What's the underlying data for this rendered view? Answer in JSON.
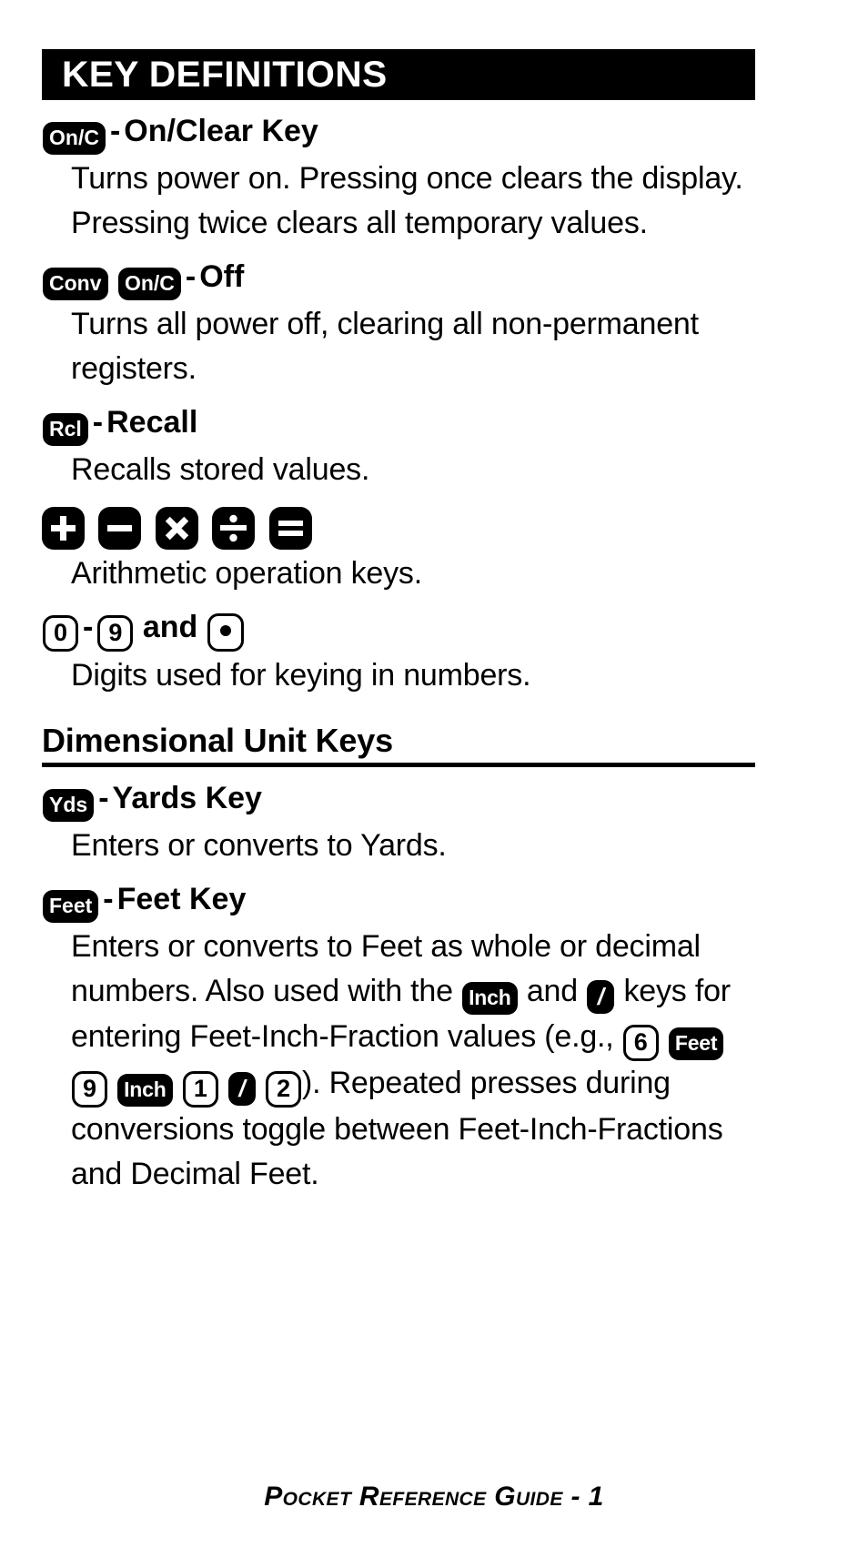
{
  "header": {
    "title": "KEY DEFINITIONS"
  },
  "entries": [
    {
      "id": "on-clear",
      "keys": [
        "On/C"
      ],
      "separator": "-",
      "title": "On/Clear Key",
      "body": "Turns power on. Pressing once clears the display. Pressing twice clears all temporary values."
    },
    {
      "id": "off",
      "keys": [
        "Conv",
        "On/C"
      ],
      "separator": "-",
      "title": "Off",
      "body": "Turns all power off, clearing all non-permanent registers."
    },
    {
      "id": "recall",
      "keys": [
        "Rcl"
      ],
      "separator": "-",
      "title": "Recall",
      "body": "Recalls stored values."
    },
    {
      "id": "arithmetic",
      "keys": [
        "plus",
        "minus",
        "multiply",
        "divide",
        "equals"
      ],
      "separator": "",
      "title": "",
      "body": "Arithmetic operation keys."
    },
    {
      "id": "digits",
      "keys": [
        "0",
        "9",
        "."
      ],
      "separator": "-",
      "title": "and",
      "body": "Digits used for keying in numbers."
    }
  ],
  "section": {
    "heading": "Dimensional Unit Keys"
  },
  "unit_entries": [
    {
      "id": "yards",
      "keys": [
        "Yds"
      ],
      "separator": "-",
      "title": "Yards Key",
      "body": "Enters or converts to Yards."
    },
    {
      "id": "feet",
      "keys": [
        "Feet"
      ],
      "separator": "-",
      "title": "Feet Key",
      "body_part_1": "Enters or converts to Feet as whole or decimal numbers. Also used with the",
      "inline_key_1": "Inch",
      "body_part_2": "and",
      "inline_key_2": "/",
      "body_part_3": "keys for entering Feet-Inch-Fraction values (e.g.,",
      "example_keys": [
        "6",
        "Feet",
        "9",
        "Inch",
        "1",
        "/",
        "2"
      ],
      "body_part_4": "). Repeated presses during conversions toggle between Feet-Inch-Fractions and Decimal Feet."
    }
  ],
  "footer": {
    "text": "Pocket Reference Guide - 1"
  },
  "colors": {
    "ink": "#000000",
    "paper": "#ffffff"
  }
}
